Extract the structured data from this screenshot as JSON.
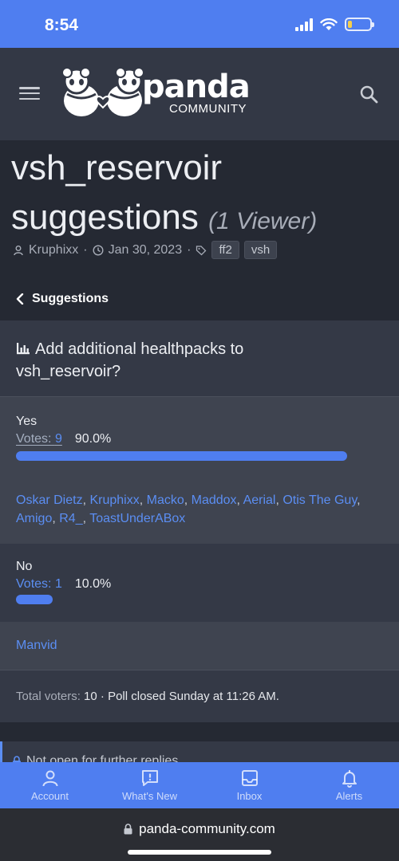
{
  "status": {
    "time": "8:54"
  },
  "header": {
    "logo_word": "panda",
    "logo_sub": "COMMUNITY"
  },
  "thread": {
    "title": "vsh_reservoir suggestions",
    "viewers": "(1 Viewer)",
    "author": "Kruphixx",
    "date": "Jan 30, 2023",
    "tags": [
      "ff2",
      "vsh"
    ]
  },
  "breadcrumb": {
    "label": "Suggestions"
  },
  "poll": {
    "question": "Add additional healthpacks to vsh_reservoir?",
    "options": [
      {
        "label": "Yes",
        "votes_label": "Votes:",
        "votes": "9",
        "percent_text": "90.0%",
        "percent": 90.0,
        "voters": [
          "Oskar Dietz",
          "Kruphixx",
          "Macko",
          "Maddox",
          "Aerial",
          "Otis The Guy",
          "Amigo",
          "R4_",
          "ToastUnderABox"
        ]
      },
      {
        "label": "No",
        "votes_label": "Votes:",
        "votes": "1",
        "percent_text": "10.0%",
        "percent": 10.0,
        "voters": [
          "Manvid"
        ]
      }
    ],
    "total_label": "Total voters:",
    "total_voters": "10",
    "closed_text": "· Poll closed Sunday at 11:26 AM."
  },
  "notice": {
    "text": "Not open for further replies."
  },
  "tabs": [
    {
      "label": "Account",
      "icon": "account-icon"
    },
    {
      "label": "What's New",
      "icon": "whats-new-icon"
    },
    {
      "label": "Inbox",
      "icon": "inbox-icon"
    },
    {
      "label": "Alerts",
      "icon": "alerts-icon"
    }
  ],
  "browser": {
    "url": "panda-community.com"
  },
  "colors": {
    "accent": "#4f7ef0",
    "link": "#5b8ef3",
    "bg": "#2b2f3a"
  }
}
